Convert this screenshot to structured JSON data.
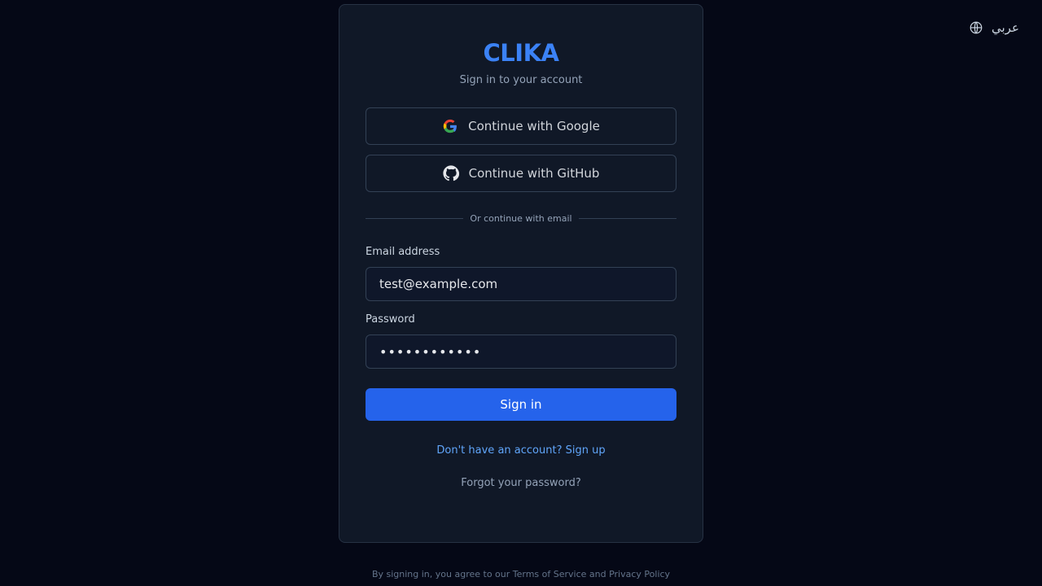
{
  "language_switch": {
    "label": "عربي",
    "icon": "globe-icon"
  },
  "card": {
    "brand": "CLIKA",
    "subtitle": "Sign in to your account",
    "google_button": {
      "label": "Continue with Google",
      "icon": "google-icon"
    },
    "github_button": {
      "label": "Continue with GitHub",
      "icon": "github-icon"
    },
    "divider_text": "Or continue with email",
    "email": {
      "label": "Email address",
      "value": "test@example.com"
    },
    "password": {
      "label": "Password",
      "value": "............"
    },
    "signin_label": "Sign in",
    "signup_link": "Don't have an account? Sign up",
    "forgot_link": "Forgot your password?"
  },
  "footer": {
    "text": "By signing in, you agree to our Terms of Service and Privacy Policy"
  },
  "colors": {
    "background": "#050816",
    "card": "#101827",
    "accent": "#2563eb",
    "brand": "#3b82f6",
    "link": "#60a5fa"
  }
}
